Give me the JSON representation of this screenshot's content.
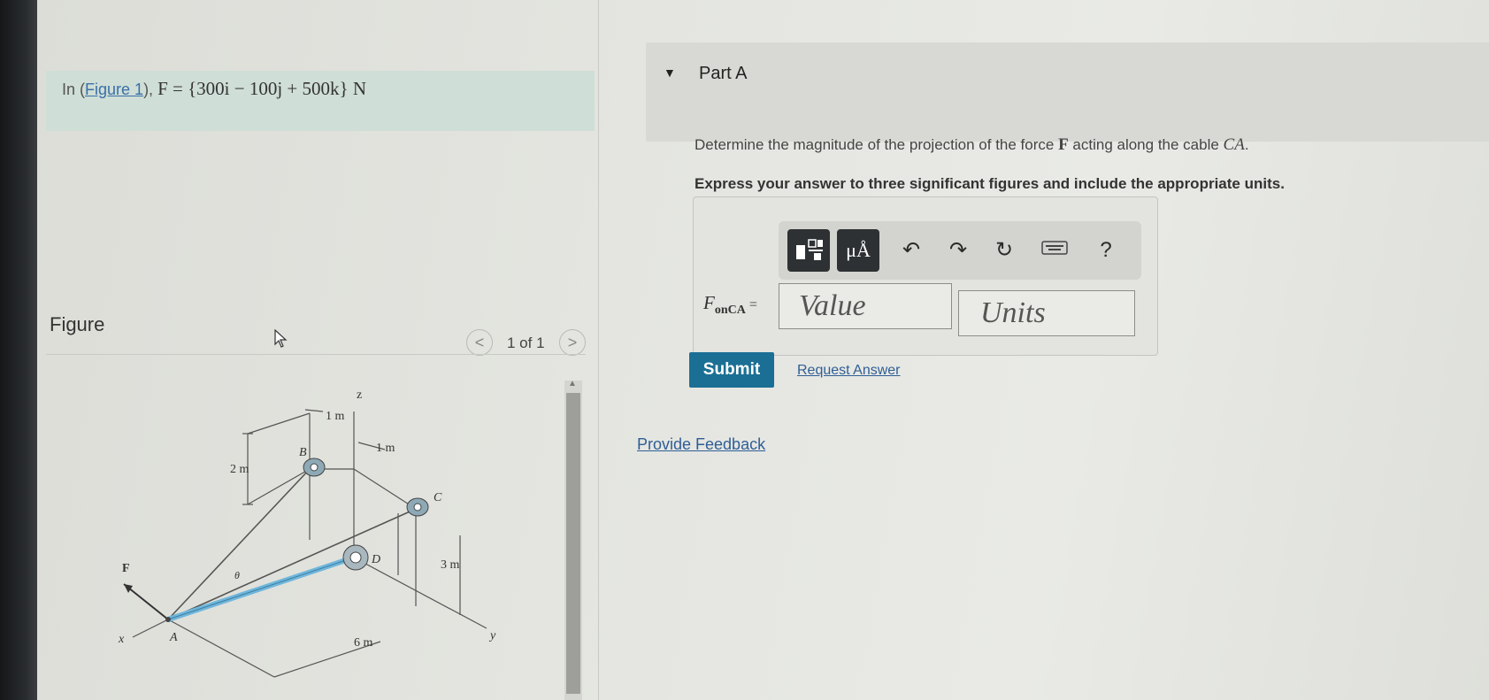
{
  "problem": {
    "prefix": "In (",
    "figure_link": "Figure 1",
    "suffix": "), ",
    "force_expression": "F = {300i − 100j + 500k} N"
  },
  "part": {
    "title": "Part A",
    "question_prefix": "Determine the magnitude of the projection of the force ",
    "question_F": "F",
    "question_mid": " acting along the cable ",
    "question_cable": "CA",
    "question_end": ".",
    "instruction": "Express your answer to three significant figures and include the appropriate units."
  },
  "answer": {
    "label_main": "F",
    "label_sub": "onCA",
    "equals": " =",
    "value_placeholder": "Value",
    "units_placeholder": "Units"
  },
  "toolbar": {
    "templates_icon": "templates-icon",
    "units_button": "μÅ",
    "undo_icon": "undo-icon",
    "redo_icon": "redo-icon",
    "reset_icon": "reset-icon",
    "keyboard_icon": "keyboard-icon",
    "help": "?"
  },
  "actions": {
    "submit": "Submit",
    "request_answer": "Request Answer",
    "provide_feedback": "Provide Feedback"
  },
  "figure": {
    "heading": "Figure",
    "pager_prev": "<",
    "pager_next": ">",
    "pager_count": "1 of 1",
    "labels": {
      "z": "z",
      "one_m_top": "1 m",
      "one_m_right": "1 m",
      "two_m": "2 m",
      "B": "B",
      "C": "C",
      "D": "D",
      "F": "F",
      "theta": "θ",
      "three_m": "3 m",
      "A": "A",
      "x": "x",
      "six_m": "6 m",
      "y": "y"
    }
  },
  "colors": {
    "submit_bg": "#1b6f94",
    "link": "#2f5e96",
    "problem_bar": "#cfded6",
    "cable_blue": "#6fb6dc"
  }
}
